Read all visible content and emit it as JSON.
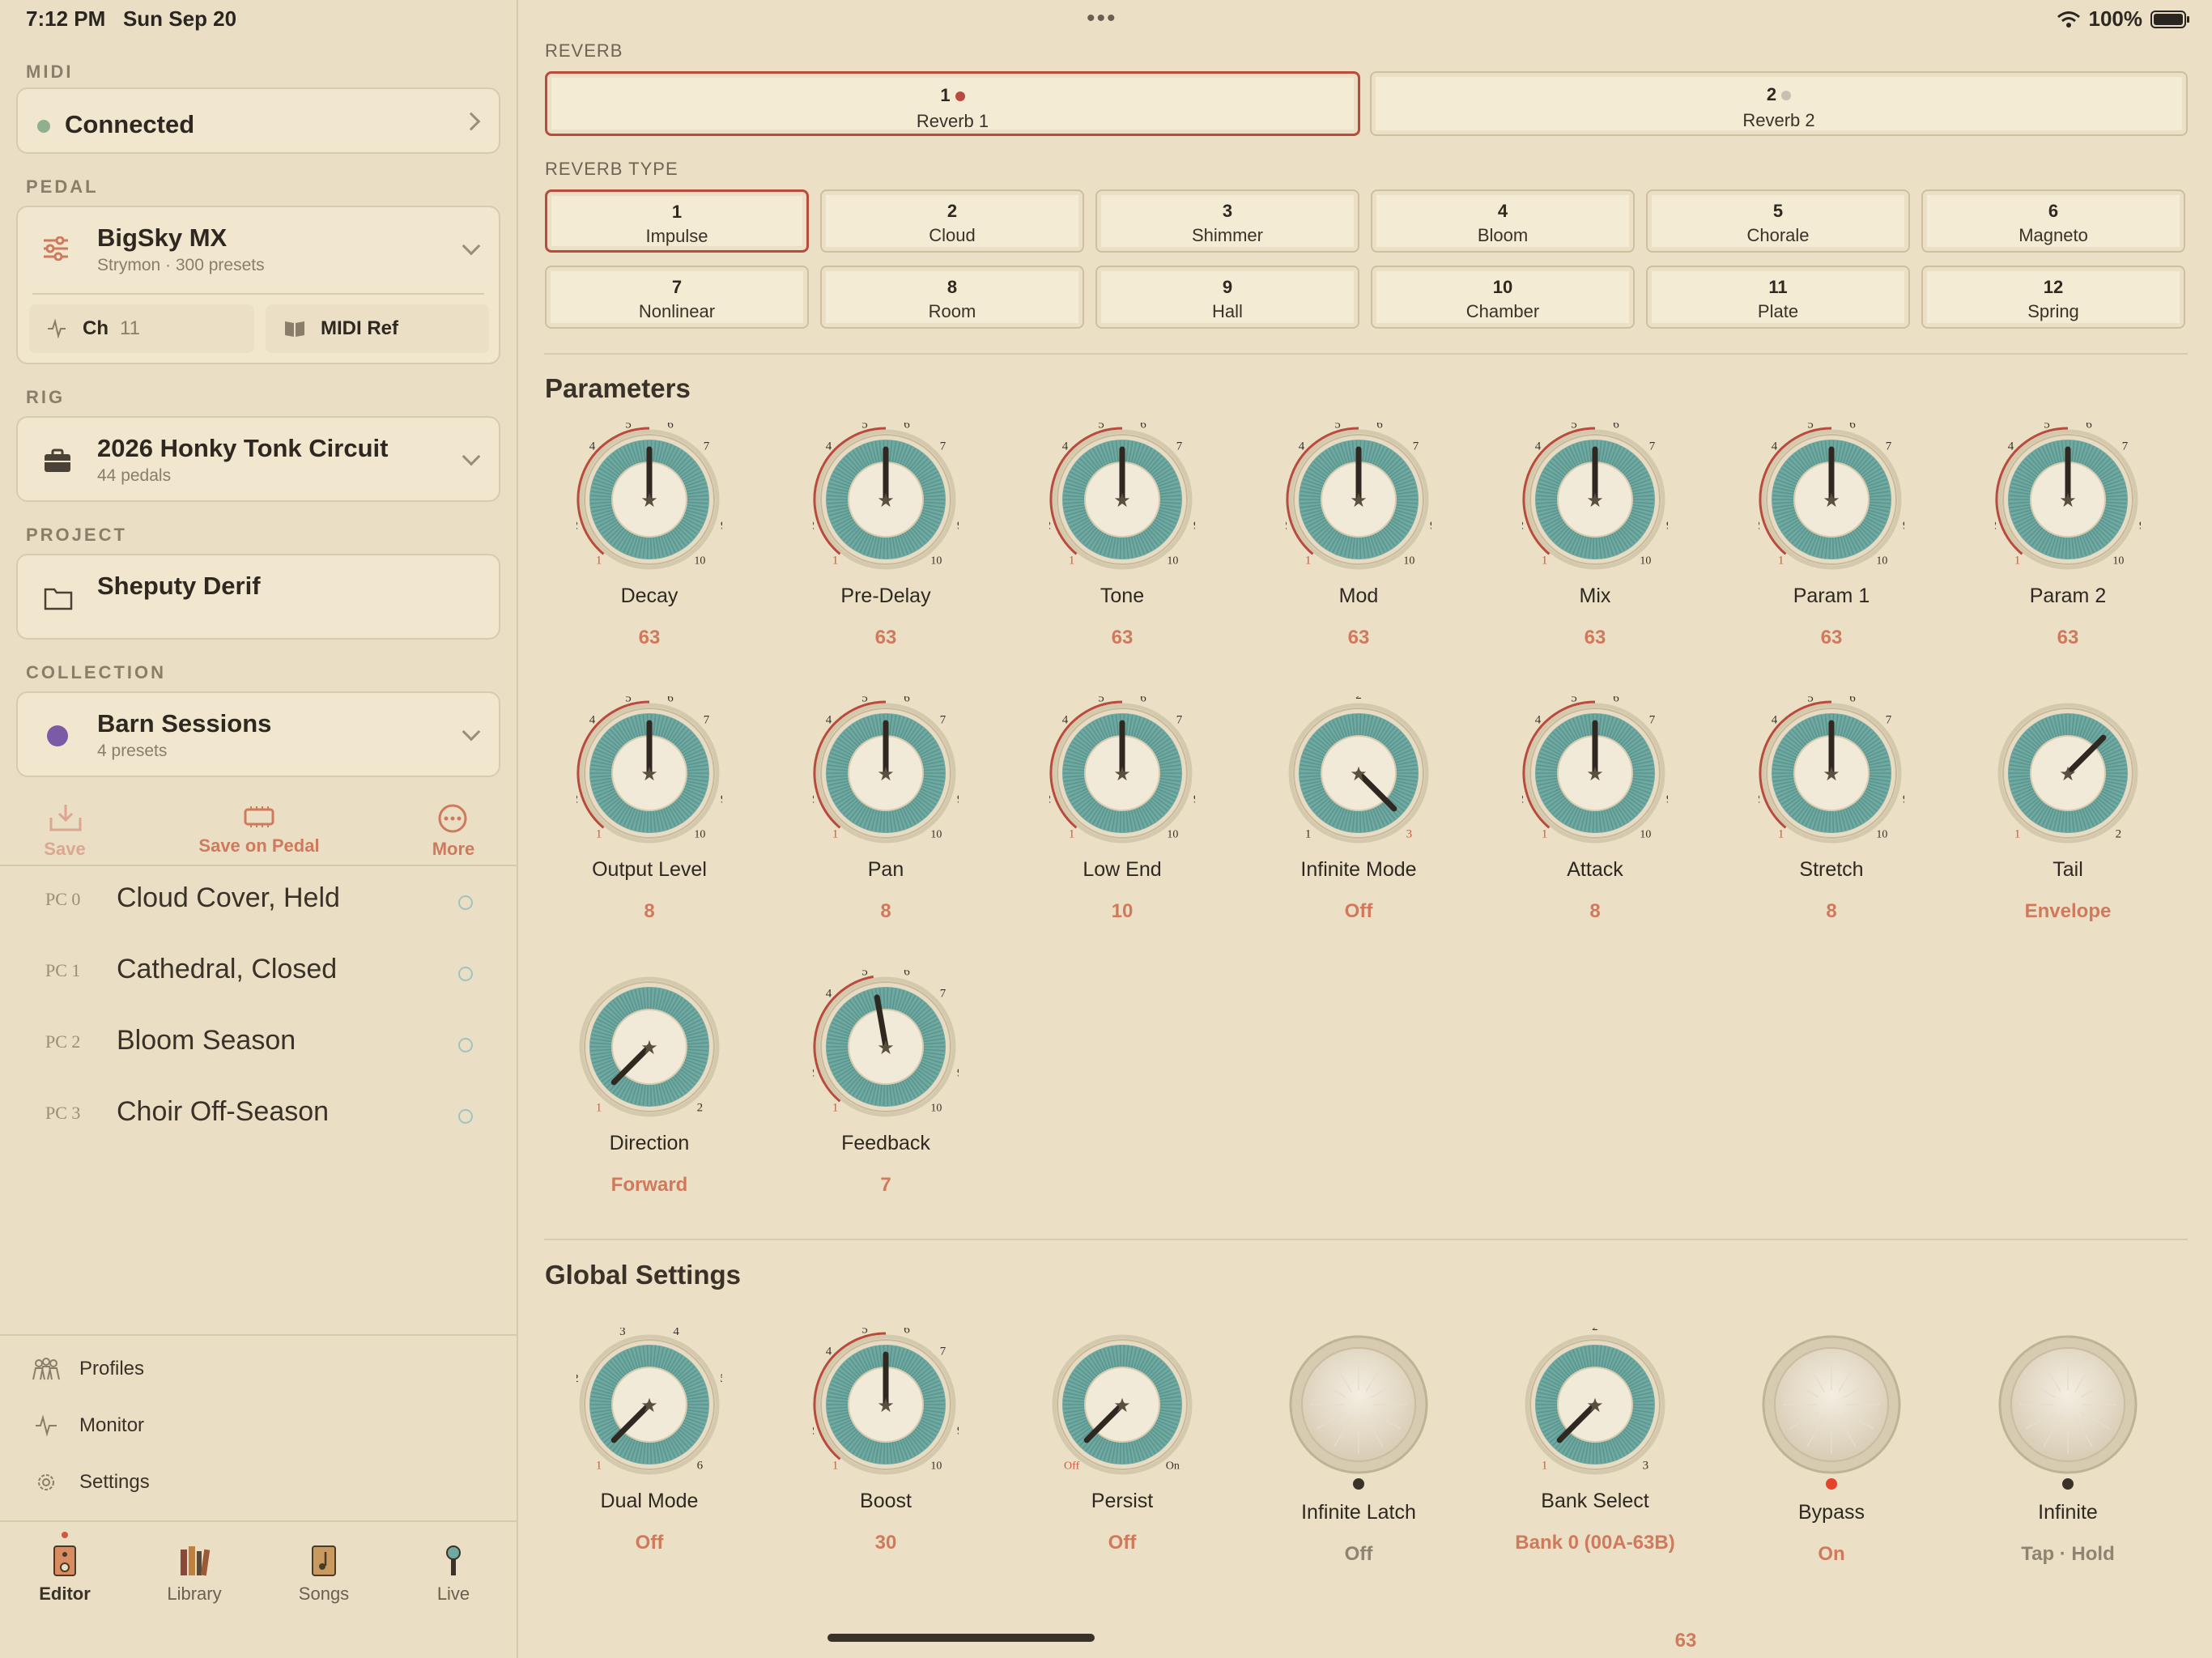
{
  "status": {
    "time": "7:12 PM",
    "date": "Sun Sep 20",
    "battery": "100%"
  },
  "sidebar": {
    "midi": {
      "label": "MIDI",
      "status": "Connected",
      "status_color": "#8fb08f"
    },
    "pedal": {
      "label": "PEDAL",
      "name": "BigSky MX",
      "sub": "Strymon · 300 presets",
      "channel_label": "Ch",
      "channel": "11",
      "midi_ref": "MIDI Ref"
    },
    "rig": {
      "label": "RIG",
      "name": "2026 Honky Tonk Circuit",
      "sub": "44 pedals"
    },
    "project": {
      "label": "PROJECT",
      "name": "Sheputy Derif"
    },
    "collection": {
      "label": "COLLECTION",
      "name": "Barn Sessions",
      "sub": "4 presets",
      "color": "#7b5aa6"
    },
    "actions": {
      "save": "Save",
      "save_on_pedal": "Save on Pedal",
      "more": "More"
    },
    "presets": [
      {
        "pc": "PC 0",
        "name": "Cloud Cover, Held"
      },
      {
        "pc": "PC 1",
        "name": "Cathedral, Closed"
      },
      {
        "pc": "PC 2",
        "name": "Bloom Season"
      },
      {
        "pc": "PC 3",
        "name": "Choir Off-Season"
      }
    ],
    "nav": {
      "profiles": "Profiles",
      "monitor": "Monitor",
      "settings": "Settings"
    },
    "tabs": {
      "editor": "Editor",
      "library": "Library",
      "songs": "Songs",
      "live": "Live"
    }
  },
  "main": {
    "reverb_label": "REVERB",
    "reverbs": [
      {
        "num": "1",
        "name": "Reverb 1"
      },
      {
        "num": "2",
        "name": "Reverb 2"
      }
    ],
    "type_label": "REVERB TYPE",
    "types": [
      {
        "num": "1",
        "name": "Impulse"
      },
      {
        "num": "2",
        "name": "Cloud"
      },
      {
        "num": "3",
        "name": "Shimmer"
      },
      {
        "num": "4",
        "name": "Bloom"
      },
      {
        "num": "5",
        "name": "Chorale"
      },
      {
        "num": "6",
        "name": "Magneto"
      },
      {
        "num": "7",
        "name": "Nonlinear"
      },
      {
        "num": "8",
        "name": "Room"
      },
      {
        "num": "9",
        "name": "Hall"
      },
      {
        "num": "10",
        "name": "Chamber"
      },
      {
        "num": "11",
        "name": "Plate"
      },
      {
        "num": "12",
        "name": "Spring"
      }
    ],
    "parameters_title": "Parameters",
    "parameters": [
      {
        "label": "Decay",
        "value": "63"
      },
      {
        "label": "Pre-Delay",
        "value": "63"
      },
      {
        "label": "Tone",
        "value": "63"
      },
      {
        "label": "Mod",
        "value": "63"
      },
      {
        "label": "Mix",
        "value": "63"
      },
      {
        "label": "Param 1",
        "value": "63"
      },
      {
        "label": "Param 2",
        "value": "63"
      },
      {
        "label": "Output Level",
        "value": "8"
      },
      {
        "label": "Pan",
        "value": "8"
      },
      {
        "label": "Low End",
        "value": "10"
      },
      {
        "label": "Infinite Mode",
        "value": "Off"
      },
      {
        "label": "Attack",
        "value": "8"
      },
      {
        "label": "Stretch",
        "value": "8"
      },
      {
        "label": "Tail",
        "value": "Envelope"
      },
      {
        "label": "Direction",
        "value": "Forward"
      },
      {
        "label": "Feedback",
        "value": "7"
      }
    ],
    "global_title": "Global Settings",
    "globals": [
      {
        "label": "Dual Mode",
        "value": "Off"
      },
      {
        "label": "Boost",
        "value": "30"
      },
      {
        "label": "Persist",
        "value": "Off"
      },
      {
        "label": "Infinite Latch",
        "value": "Off"
      },
      {
        "label": "Bank Select",
        "value": "Bank 0 (00A-63B)"
      },
      {
        "label": "Bypass",
        "value": "On"
      },
      {
        "label": "Infinite",
        "value": "Tap · Hold"
      }
    ],
    "footer_value": "63",
    "tick_labels": {
      "ten": [
        "1",
        "2",
        "3",
        "4",
        "5",
        "6",
        "7",
        "8",
        "9",
        "10"
      ],
      "three": [
        "1",
        "2",
        "3"
      ],
      "two": [
        "1",
        "2"
      ],
      "dual": [
        "1",
        "2",
        "3",
        "4",
        "5",
        "6"
      ],
      "onoff": [
        "Off",
        "On"
      ]
    }
  },
  "colors": {
    "accent": "#b94a3e",
    "value": "#cf7a5c",
    "knob_teal": "#6fa9a2",
    "bg": "#ebe0c6"
  }
}
